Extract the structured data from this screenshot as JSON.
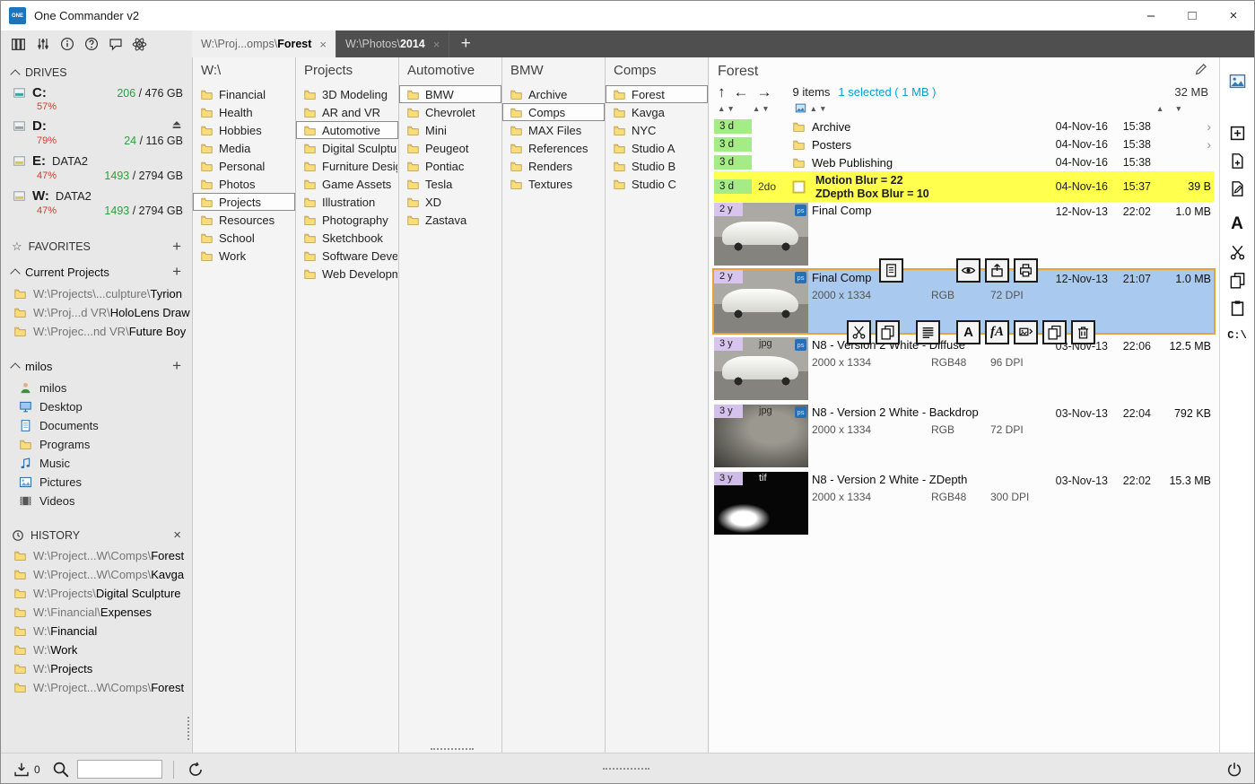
{
  "window": {
    "title": "One Commander v2",
    "logo_text": "ONE"
  },
  "colors": {
    "accent_blue": "#00a3d9",
    "selection_fill": "#a9c9ee",
    "selection_border": "#e8a23c",
    "note_yellow": "#ffff4d",
    "badge_recent": "#a5ec86",
    "badge_old": "#d9c6f2"
  },
  "toolbar": {
    "icons": [
      "layout-columns",
      "filters",
      "info",
      "help",
      "feedback",
      "settings-atom"
    ]
  },
  "tabs": [
    {
      "prefix": "W:\\Proj...omps\\",
      "name": "Forest",
      "active": true
    },
    {
      "prefix": "W:\\Photos\\",
      "name": "2014",
      "active": false
    }
  ],
  "sidebar": {
    "drives": {
      "header": "DRIVES",
      "sep": "/",
      "items": [
        {
          "letter": "C:",
          "percent": "57%",
          "free": "206",
          "total": "476 GB",
          "eject": false,
          "vals_line": 1,
          "color": "#3aa6a0"
        },
        {
          "letter": "D:",
          "percent": "79%",
          "free": "24",
          "total": "116 GB",
          "eject": true,
          "vals_line": 2,
          "color": "#9aa0a6"
        },
        {
          "letter": "E:",
          "label": "DATA2",
          "percent": "47%",
          "free": "1493",
          "total": "2794 GB",
          "eject": false,
          "vals_line": 2,
          "color": "#d8c66e"
        },
        {
          "letter": "W:",
          "label": "DATA2",
          "percent": "47%",
          "free": "1493",
          "total": "2794 GB",
          "eject": false,
          "vals_line": 2,
          "color": "#d8c66e"
        }
      ]
    },
    "favorites": {
      "header": "FAVORITES",
      "group_label": "Current Projects",
      "items": [
        {
          "prefix": "W:\\Projects\\...culpture\\",
          "name": "Tyrion"
        },
        {
          "prefix": "W:\\Proj...d VR\\",
          "name": "HoloLens Draw"
        },
        {
          "prefix": "W:\\Projec...nd VR\\",
          "name": "Future Boy"
        }
      ]
    },
    "user": {
      "label": "milos",
      "items": [
        {
          "name": "milos",
          "icon": "user"
        },
        {
          "name": "Desktop",
          "icon": "desktop"
        },
        {
          "name": "Documents",
          "icon": "documents"
        },
        {
          "name": "Programs",
          "icon": "folder"
        },
        {
          "name": "Music",
          "icon": "music"
        },
        {
          "name": "Pictures",
          "icon": "pictures"
        },
        {
          "name": "Videos",
          "icon": "videos"
        }
      ]
    },
    "history": {
      "header": "HISTORY",
      "items": [
        {
          "prefix": "W:\\Project...W\\Comps\\",
          "name": "Forest"
        },
        {
          "prefix": "W:\\Project...W\\Comps\\",
          "name": "Kavga"
        },
        {
          "prefix": "W:\\Projects\\",
          "name": "Digital Sculpture"
        },
        {
          "prefix": "W:\\Financial\\",
          "name": "Expenses"
        },
        {
          "prefix": "W:\\",
          "name": "Financial"
        },
        {
          "prefix": "W:\\",
          "name": "Work"
        },
        {
          "prefix": "W:\\",
          "name": "Projects"
        },
        {
          "prefix": "W:\\Project...W\\Comps\\",
          "name": "Forest"
        }
      ]
    }
  },
  "columns": [
    {
      "header": "W:\\",
      "items": [
        {
          "name": "Financial"
        },
        {
          "name": "Health"
        },
        {
          "name": "Hobbies"
        },
        {
          "name": "Media"
        },
        {
          "name": "Personal"
        },
        {
          "name": "Photos"
        },
        {
          "name": "Projects",
          "selected": true
        },
        {
          "name": "Resources"
        },
        {
          "name": "School"
        },
        {
          "name": "Work"
        }
      ]
    },
    {
      "header": "Projects",
      "items": [
        {
          "name": "3D Modeling"
        },
        {
          "name": "AR and VR"
        },
        {
          "name": "Automotive",
          "selected": true
        },
        {
          "name": "Digital Sculptur"
        },
        {
          "name": "Furniture Desig"
        },
        {
          "name": "Game Assets"
        },
        {
          "name": "Illustration"
        },
        {
          "name": "Photography"
        },
        {
          "name": "Sketchbook"
        },
        {
          "name": "Software Devel"
        },
        {
          "name": "Web Developm"
        }
      ]
    },
    {
      "header": "Automotive",
      "items": [
        {
          "name": "BMW",
          "selected": true
        },
        {
          "name": "Chevrolet"
        },
        {
          "name": "Mini"
        },
        {
          "name": "Peugeot"
        },
        {
          "name": "Pontiac"
        },
        {
          "name": "Tesla"
        },
        {
          "name": "XD"
        },
        {
          "name": "Zastava"
        }
      ]
    },
    {
      "header": "BMW",
      "items": [
        {
          "name": "Archive"
        },
        {
          "name": "Comps",
          "selected": true
        },
        {
          "name": "MAX Files"
        },
        {
          "name": "References"
        },
        {
          "name": "Renders"
        },
        {
          "name": "Textures"
        }
      ]
    },
    {
      "header": "Comps",
      "items": [
        {
          "name": "Forest",
          "selected": true
        },
        {
          "name": "Kavga"
        },
        {
          "name": "NYC"
        },
        {
          "name": "Studio A"
        },
        {
          "name": "Studio B"
        },
        {
          "name": "Studio C"
        }
      ]
    }
  ],
  "filepanel": {
    "title": "Forest",
    "counts": {
      "items": "9 items",
      "selected": "1 selected ( 1 MB )",
      "total": "32 MB"
    },
    "labels": {
      "rename_a": "A",
      "rename_fa": "fA"
    },
    "selection_toolbar": {
      "top_left": [
        "copy-name"
      ],
      "top_right": [
        "preview-eye",
        "open-location",
        "print"
      ],
      "bottom_left": [
        "cut",
        "copy"
      ],
      "bottom_mid": [
        "menu-lines"
      ],
      "bottom_right": [
        "rename-a",
        "rename-fa",
        "convert-image",
        "duplicate",
        "delete"
      ]
    },
    "files": [
      {
        "kind": "folder",
        "age": "3 d",
        "name": "Archive",
        "date": "04-Nov-16",
        "time": "15:38",
        "chevron": true
      },
      {
        "kind": "folder",
        "age": "3 d",
        "name": "Posters",
        "date": "04-Nov-16",
        "time": "15:38",
        "chevron": true
      },
      {
        "kind": "folder",
        "age": "3 d",
        "name": "Web Publishing",
        "date": "04-Nov-16",
        "time": "15:38"
      },
      {
        "kind": "note",
        "age": "3 d",
        "tag": "2do",
        "line1": "Motion Blur = 22",
        "line2": "ZDepth Box Blur = 10",
        "date": "04-Nov-16",
        "time": "15:37",
        "size": "39 B"
      },
      {
        "kind": "image",
        "age": "2 y",
        "name": "Final Comp",
        "thumb": "car",
        "ps_badge": true,
        "date": "12-Nov-13",
        "time": "22:02",
        "size": "1.0 MB"
      },
      {
        "kind": "image",
        "age": "2 y",
        "name": "Final Comp",
        "thumb": "car",
        "ps_badge": true,
        "selected": true,
        "dims": "2000 x 1334",
        "colorspace": "RGB",
        "dpi": "72 DPI",
        "date": "12-Nov-13",
        "time": "21:07",
        "size": "1.0 MB"
      },
      {
        "kind": "image",
        "age": "3 y",
        "name": "N8 - Version 2 White - Diffuse",
        "thumb": "car",
        "filetype": "jpg",
        "ps_badge": true,
        "dims": "2000 x 1334",
        "colorspace": "RGB48",
        "dpi": "96 DPI",
        "date": "03-Nov-13",
        "time": "22:06",
        "size": "12.5 MB"
      },
      {
        "kind": "image",
        "age": "3 y",
        "name": "N8 - Version 2 White - Backdrop",
        "thumb": "blur",
        "filetype": "jpg",
        "ps_badge": true,
        "dims": "2000 x 1334",
        "colorspace": "RGB",
        "dpi": "72 DPI",
        "date": "03-Nov-13",
        "time": "22:04",
        "size": "792 KB"
      },
      {
        "kind": "image",
        "age": "3 y",
        "name": "N8 - Version 2 White - ZDepth",
        "thumb": "zdepth",
        "filetype": "tif",
        "dims": "2000 x 1334",
        "colorspace": "RGB48",
        "dpi": "300 DPI",
        "date": "03-Nov-13",
        "time": "22:02",
        "size": "15.3 MB"
      }
    ]
  },
  "righttools": {
    "icons": [
      "preview-panel",
      "new-folder",
      "new-file",
      "edit-file",
      "text-a",
      "cut",
      "copy",
      "clipboard",
      "terminal"
    ],
    "text_a": "A",
    "terminal_label": "C:\\"
  },
  "statusbar": {
    "queue": "0",
    "search_value": ""
  }
}
